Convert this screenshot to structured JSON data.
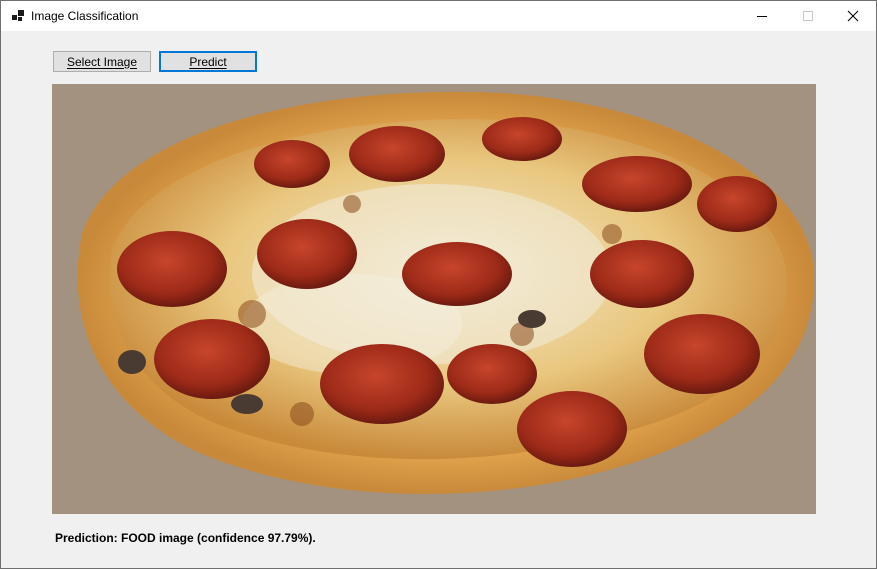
{
  "window": {
    "title": "Image Classification",
    "icon": "app-icon",
    "controls": [
      "minimize-icon",
      "maximize-icon",
      "close-icon"
    ]
  },
  "toolbar": {
    "select_image_label": "Select Image",
    "predict_label": "Predict"
  },
  "preview": {
    "subject": "pepperoni pizza photo"
  },
  "result": {
    "prediction_text": "Prediction: FOOD image (confidence 97.79%)."
  },
  "colors": {
    "accent": "#0078d7",
    "button_face": "#e1e1e1",
    "window_bg": "#f0f0f0"
  }
}
